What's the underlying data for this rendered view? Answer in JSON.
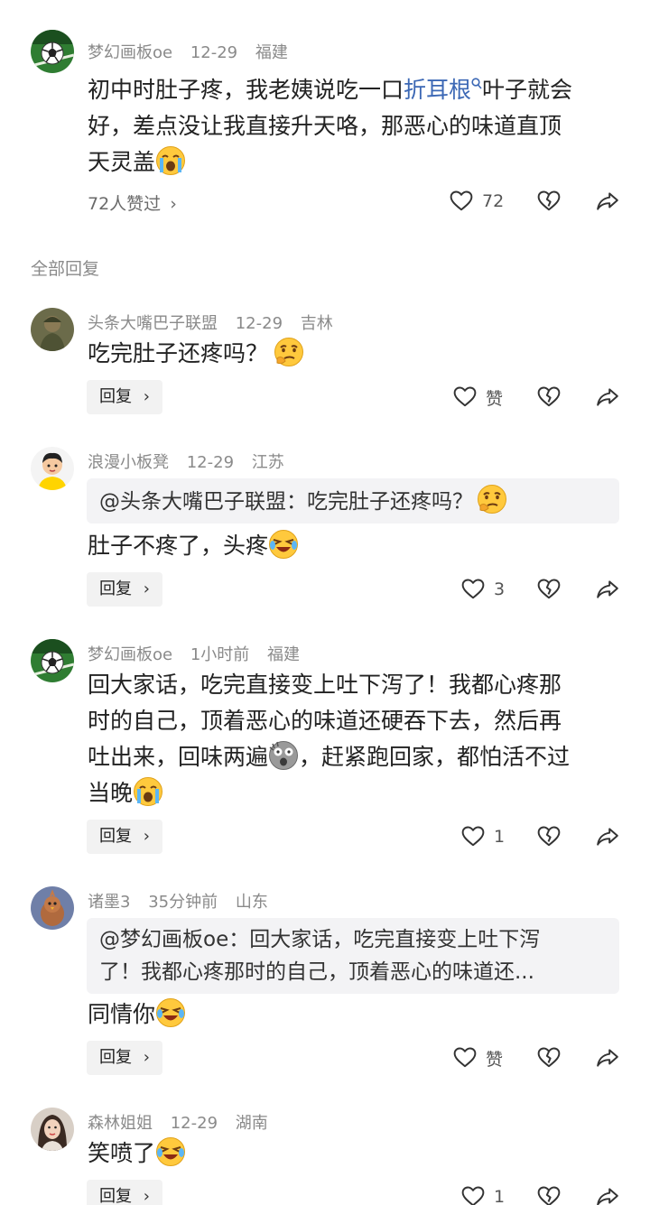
{
  "main_comment": {
    "user": "梦幻画板oe",
    "time": "12-29",
    "location": "福建",
    "text_before_link": "初中时肚子疼，我老姨说吃一口",
    "link_text": "折耳根",
    "text_line_1_after": "叶子就会",
    "text_line_2": "好，差点没让我直接升天咯，那恶心的味道直顶",
    "text_line_3": "天灵盖",
    "likes_summary": "72人赞过",
    "like_count": "72"
  },
  "section": {
    "title": "全部回复"
  },
  "replies": [
    {
      "user": "头条大嘴巴子联盟",
      "time": "12-29",
      "location": "吉林",
      "text": "吃完肚子还疼吗？",
      "reply_label": "回复",
      "like_label": "赞"
    },
    {
      "user": "浪漫小板凳",
      "time": "12-29",
      "location": "江苏",
      "quote": "@头条大嘴巴子联盟：吃完肚子还疼吗？",
      "text": "肚子不疼了，头疼",
      "reply_label": "回复",
      "like_label": "3"
    },
    {
      "user": "梦幻画板oe",
      "time": "1小时前",
      "location": "福建",
      "text_line_1": "回大家话，吃完直接变上吐下泻了！我都心疼那",
      "text_line_2": "时的自己，顶着恶心的味道还硬吞下去，然后再",
      "text_line_3a": "吐出来，回味两遍",
      "text_line_3b": "，赶紧跑回家，都怕活不过",
      "text_line_4": "当晚",
      "reply_label": "回复",
      "like_label": "1"
    },
    {
      "user": "诸墨3",
      "time": "35分钟前",
      "location": "山东",
      "quote_line_1": "@梦幻画板oe：回大家话，吃完直接变上吐下泻",
      "quote_line_2": "了！我都心疼那时的自己，顶着恶心的味道还...",
      "text": "同情你",
      "reply_label": "回复",
      "like_label": "赞"
    },
    {
      "user": "森林姐姐",
      "time": "12-29",
      "location": "湖南",
      "text": "笑喷了",
      "reply_label": "回复",
      "like_label": "1"
    }
  ],
  "colors": {
    "link": "#3c68b5",
    "meta": "#8a8a8a",
    "reply_bg": "#f2f2f2",
    "quote_bg": "#f3f3f5"
  },
  "icons": [
    "soccer-avatar",
    "search-icon",
    "heart-icon",
    "broken-heart-icon",
    "share-icon",
    "chevron-right-icon",
    "crying-emoji",
    "thinking-emoji",
    "laughing-crying-emoji",
    "shocked-emoji"
  ]
}
